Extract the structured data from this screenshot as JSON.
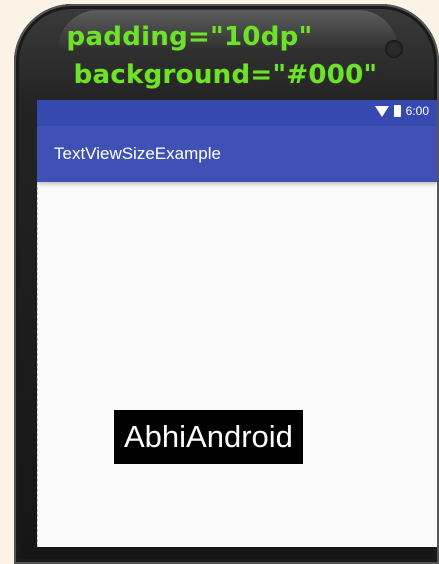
{
  "annotation": {
    "line1": "padding=\"10dp\"",
    "line2": "background=\"#000\"",
    "color": "#6ee12a"
  },
  "status_bar": {
    "time": "6:00",
    "icons": [
      "wifi-icon",
      "battery-icon"
    ],
    "color": "#3649b0"
  },
  "app_bar": {
    "title": "TextViewSizeExample",
    "color": "#3f51b5"
  },
  "content": {
    "text_view": {
      "text": "AbhiAndroid",
      "background": "#000000",
      "text_color": "#ffffff"
    }
  }
}
